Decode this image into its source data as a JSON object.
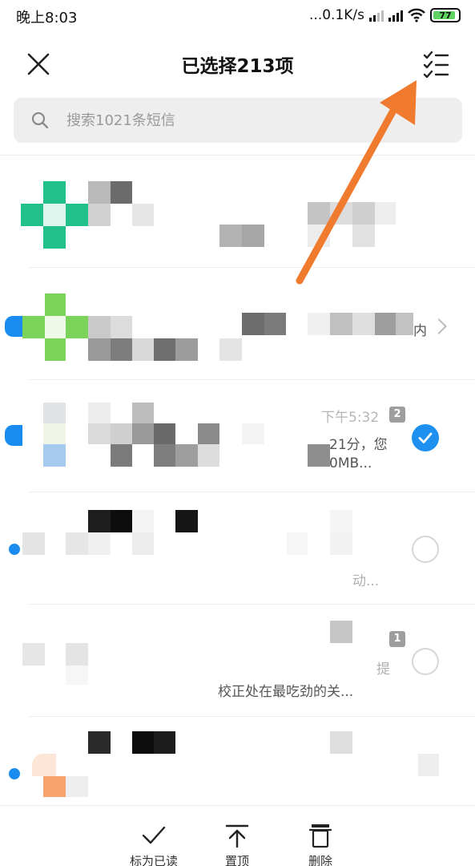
{
  "status_bar": {
    "time": "晚上8:03",
    "network_speed": "...0.1K/s",
    "battery_level": "77",
    "icons": [
      "signal-icon",
      "signal-icon",
      "wifi-icon",
      "battery-icon"
    ]
  },
  "header": {
    "title": "已选择213项",
    "close_icon": "close-icon",
    "multiselect_icon": "checklist-icon"
  },
  "search": {
    "placeholder": "搜索1021条短信"
  },
  "conversations": [
    {
      "time": "",
      "badge": "",
      "snippet_1": "",
      "snippet_2": "",
      "selected": false,
      "unread": false
    },
    {
      "time": "",
      "badge": "",
      "snippet_1": "内",
      "snippet_2": "",
      "selected": false,
      "unread": true
    },
    {
      "time": "下午5:32",
      "badge": "2",
      "snippet_1": "21分，您",
      "snippet_2": "0MB...",
      "selected": true,
      "unread": true
    },
    {
      "time": "",
      "badge": "",
      "snippet_1": "",
      "snippet_2": "动...",
      "selected": false,
      "unread": true
    },
    {
      "time": "",
      "badge": "1",
      "snippet_1": "提",
      "snippet_2": "校正处在最吃劲的关...",
      "selected": false,
      "unread": false
    },
    {
      "time": "",
      "badge": "",
      "snippet_1": "",
      "snippet_2": "",
      "selected": false,
      "unread": true
    }
  ],
  "bottom_bar": {
    "mark_read": "标为已读",
    "pin": "置顶",
    "delete": "删除"
  },
  "colors": {
    "accent_blue": "#1e90f0",
    "arrow_orange": "#f07a2e",
    "avatar_green": "#22c08a",
    "avatar_lime": "#7bd35a"
  }
}
